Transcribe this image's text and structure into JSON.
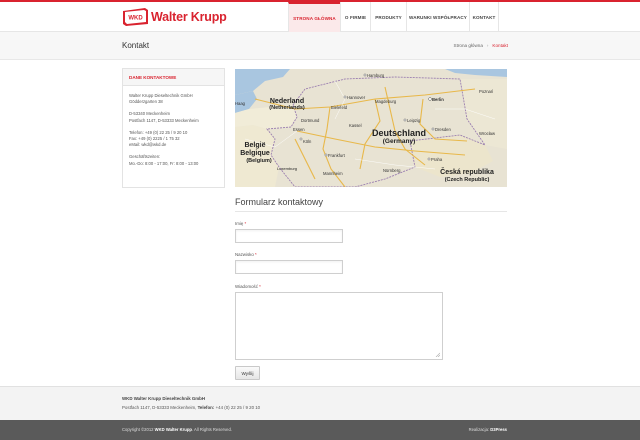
{
  "brand": {
    "name": "Walter Krupp",
    "badge_text": "WKD",
    "accent": "#d9232f"
  },
  "nav": {
    "items": [
      {
        "label": "STRONA GŁÓWNA",
        "active": true
      },
      {
        "label": "O FIRMIE",
        "active": false
      },
      {
        "label": "PRODUKTY",
        "active": false
      },
      {
        "label": "WARUNKI WSPÓŁPRACY",
        "active": false
      },
      {
        "label": "KONTAKT",
        "active": false
      }
    ]
  },
  "page": {
    "title": "Kontakt",
    "breadcrumb": {
      "home": "Strona główna",
      "separator": "›",
      "current": "Kontakt"
    }
  },
  "sidebar": {
    "heading": "DANE KONTAKTOWE",
    "lines": [
      "Walter Krupp Dieseltechnik GmbH",
      "Gödderzgarten 38",
      "D-53340 Meckenheim",
      "Postfach 1147, D-53333 Meckenheim",
      "Telefon: +49 (0) 22 25 / 9 20 10",
      "Fax: +49 (0) 2225 / 1 75 32",
      "eMail: wkd@wkd.de",
      "Geschäftszeiten:",
      "Mo.-Do: 8:00 - 17:00, Fr: 8:00 - 13:00"
    ]
  },
  "map": {
    "labels": {
      "netherlands": "Nederland",
      "netherlands_en": "(Netherlands)",
      "germany": "Deutschland",
      "germany_en": "(Germany)",
      "belgium": "België",
      "belgium_fr": "Belgique",
      "belgium_en": "(Belgium)",
      "czech": "Česká republika",
      "czech_en": "(Czech Republic)",
      "luxembourg": "Luxemburg",
      "hamburg": "Hamburg",
      "berlin": "Berlin",
      "hannover": "Hannover",
      "bielefeld": "Bielefeld",
      "magdeburg": "Magdeburg",
      "leipzig": "Leipzig",
      "dresden": "Dresden",
      "dortmund": "Dortmund",
      "essen": "Essen",
      "koln": "Köln",
      "kassel": "Kassel",
      "frankfurt": "Frankfurt",
      "praha": "Praha",
      "wroclaw": "Wrocław",
      "poznan": "Poznań",
      "hague": "Haag",
      "nurnberg": "Nürnberg",
      "mannheim": "Mannheim"
    }
  },
  "form": {
    "title": "Formularz kontaktowy",
    "first_name_label": "Imię",
    "last_name_label": "Nazwisko",
    "message_label": "Wiadomość",
    "required_mark": "*",
    "submit_label": "Wyślij"
  },
  "footer": {
    "company": "WKD Walter Krupp Dieseltechnik GmbH",
    "address": "Postfach 1147, D-53333 Meckenheim, ",
    "phone_label": "Telefon:",
    "phone": " +44 (0) 22 25 / 9 20 10",
    "copyright_prefix": "Copyright ©2012 ",
    "copyright_brand": "WKD Walter Krupp",
    "copyright_suffix": ". All Rights Reserved.",
    "credit_label": "Realizacja: ",
    "credit_name": "D3Press"
  }
}
